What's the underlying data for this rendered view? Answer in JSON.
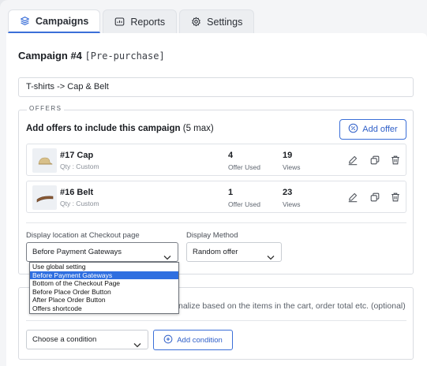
{
  "tabs": [
    {
      "label": "Campaigns",
      "icon": "layers-icon",
      "active": true
    },
    {
      "label": "Reports",
      "icon": "report-icon",
      "active": false
    },
    {
      "label": "Settings",
      "icon": "gear-icon",
      "active": false
    }
  ],
  "campaign": {
    "title": "Campaign #4",
    "stage": "[Pre-purchase]",
    "name_value": "T-shirts -> Cap & Belt"
  },
  "offers": {
    "legend": "OFFERS",
    "heading": "Add offers to include this campaign",
    "max_note": "(5 max)",
    "add_label": "Add offer",
    "items": [
      {
        "name": "#17 Cap",
        "qty": "Qty : Custom",
        "used": "4",
        "used_label": "Offer Used",
        "views": "19",
        "views_label": "Views"
      },
      {
        "name": "#16 Belt",
        "qty": "Qty : Custom",
        "used": "1",
        "used_label": "Offer Used",
        "views": "23",
        "views_label": "Views"
      }
    ]
  },
  "display": {
    "location_label": "Display location at Checkout page",
    "location_value": "Before Payment Gateways",
    "method_label": "Display Method",
    "method_value": "Random offer",
    "location_options": [
      "Use global setting",
      "Before Payment Gateways",
      "Bottom of the Checkout Page",
      "Before Place Order Button",
      "After Place Order Button",
      "Offers shortcode"
    ],
    "selected_index": 1
  },
  "conditions": {
    "text": "nalize based on the items in the cart, order total etc. (optional)",
    "select_value": "Choose a condition",
    "add_label": "Add condition"
  },
  "colors": {
    "accent": "#3b6fd8",
    "highlight": "#2f6fe0"
  }
}
